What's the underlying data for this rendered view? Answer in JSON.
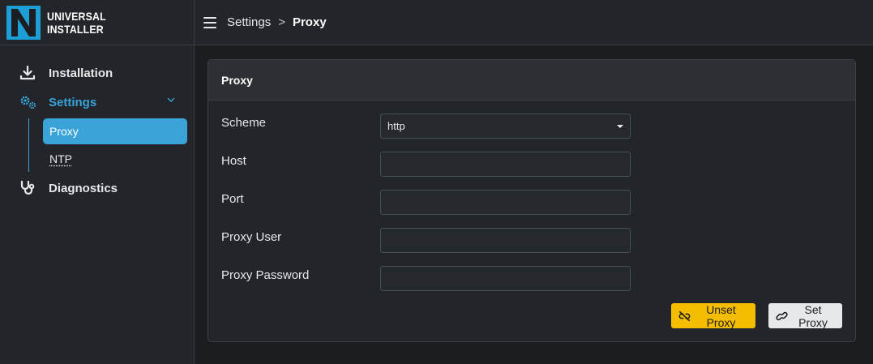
{
  "brand": {
    "line1": "UNIVERSAL",
    "line2": "INSTALLER",
    "logo_icon": "n-logo-icon",
    "accent": "#1e9ed7"
  },
  "sidebar": {
    "items": [
      {
        "label": "Installation",
        "icon": "download-icon"
      },
      {
        "label": "Settings",
        "icon": "gears-icon",
        "expanded": true,
        "children": [
          {
            "label": "Proxy",
            "selected": true
          },
          {
            "label": "NTP"
          }
        ]
      },
      {
        "label": "Diagnostics",
        "icon": "stethoscope-icon"
      }
    ]
  },
  "header": {
    "menu_icon": "hamburger-menu-icon",
    "breadcrumb": {
      "parent": "Settings",
      "separator": ">",
      "current": "Proxy"
    }
  },
  "card": {
    "title": "Proxy",
    "fields": {
      "scheme": {
        "label": "Scheme",
        "value": "http"
      },
      "host": {
        "label": "Host",
        "value": ""
      },
      "port": {
        "label": "Port",
        "value": ""
      },
      "user": {
        "label": "Proxy User",
        "value": ""
      },
      "password": {
        "label": "Proxy Password",
        "value": ""
      }
    },
    "buttons": {
      "unset": {
        "label": "Unset Proxy",
        "icon": "unlink-icon",
        "color": "#f5bd00"
      },
      "set": {
        "label": "Set Proxy",
        "icon": "link-icon",
        "color": "#e6e8ea"
      }
    }
  },
  "colors": {
    "accent": "#3aa3d8",
    "background": "#1c1d21",
    "panel": "#222529"
  }
}
